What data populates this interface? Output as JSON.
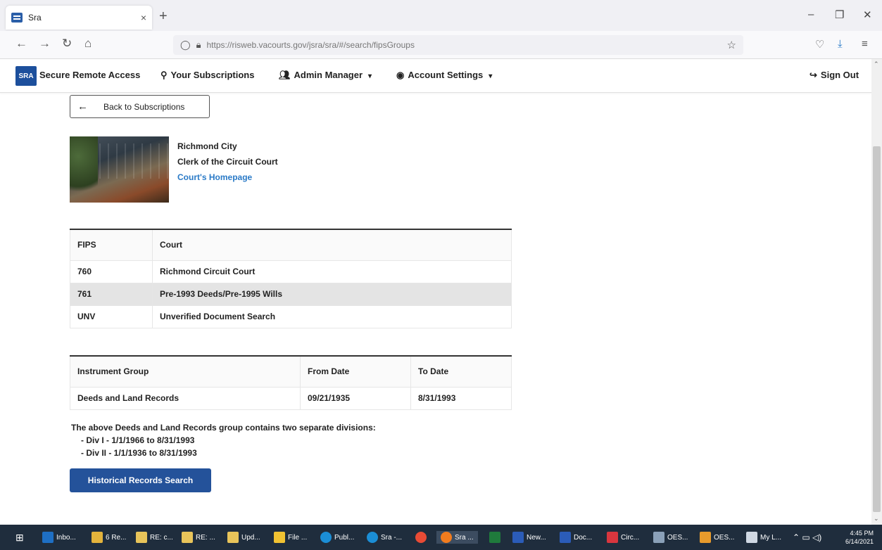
{
  "browser": {
    "tab_title": "Sra",
    "tab_close": "×",
    "new_tab": "+",
    "url": "https://risweb.vacourts.gov/jsra/sra/#/search/fipsGroups",
    "window_controls": [
      "–",
      "❐",
      "✕"
    ]
  },
  "header": {
    "logo_text": "SRA",
    "brand": "Secure Remote Access",
    "subscriptions": "Your Subscriptions",
    "admin": "Admin Manager",
    "account": "Account Settings",
    "signout": "Sign Out"
  },
  "back_button": "Back to Subscriptions",
  "court": {
    "name": "Richmond City",
    "office": "Clerk of the Circuit Court",
    "homepage_link": "Court's Homepage"
  },
  "fips_table": {
    "headers": [
      "FIPS",
      "Court"
    ],
    "rows": [
      [
        "760",
        "Richmond Circuit Court"
      ],
      [
        "761",
        "Pre-1993 Deeds/Pre-1995 Wills"
      ],
      [
        "UNV",
        "Unverified Document Search"
      ]
    ]
  },
  "instrument_table": {
    "headers": [
      "Instrument Group",
      "From Date",
      "To Date"
    ],
    "rows": [
      [
        "Deeds and Land Records",
        "09/21/1935",
        "8/31/1993"
      ]
    ]
  },
  "note": {
    "intro": "The above Deeds and Land Records group contains two separate divisions:",
    "div1": "- Div I - 1/1/1966 to 8/31/1993",
    "div2": "- Div II - 1/1/1936 to 8/31/1993"
  },
  "historical_button": "Historical Records Search",
  "taskbar": {
    "items": [
      "Inbo...",
      "6 Re...",
      "RE: c...",
      "RE: ...",
      "Upd...",
      "File ...",
      "Publ...",
      "Sra -...",
      "",
      "Sra ...",
      "",
      "New...",
      "Doc...",
      "Circ...",
      "OES...",
      "OES...",
      "My L..."
    ],
    "time": "4:45 PM",
    "date": "6/14/2021"
  },
  "colors": {
    "accent": "#24529a",
    "link": "#2a7ac7",
    "taskbar": "#1f2d3d"
  }
}
